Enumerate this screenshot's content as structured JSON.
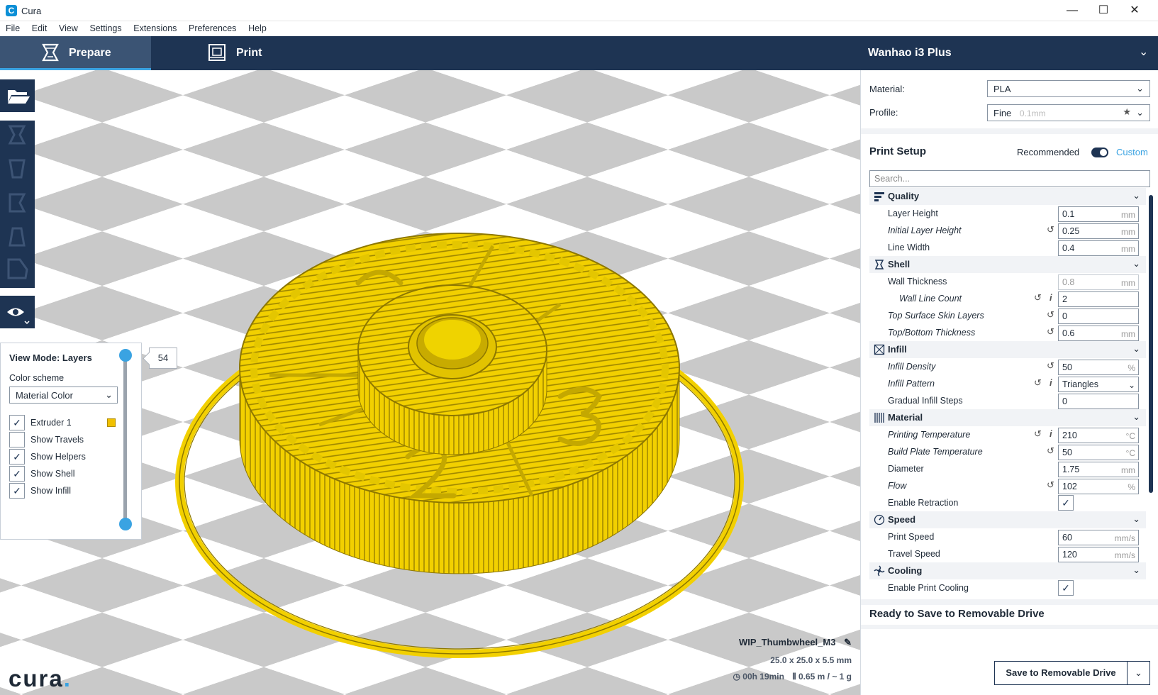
{
  "app": {
    "title": "Cura",
    "icon_letter": "C"
  },
  "window": {
    "minimize": "—",
    "maximize": "☐",
    "close": "✕"
  },
  "menu": [
    "File",
    "Edit",
    "View",
    "Settings",
    "Extensions",
    "Preferences",
    "Help"
  ],
  "tabs": {
    "prepare": "Prepare",
    "print": "Print"
  },
  "printer": {
    "name": "Wanhao i3 Plus"
  },
  "material": {
    "label": "Material:",
    "value": "PLA"
  },
  "profile": {
    "label": "Profile:",
    "value": "Fine",
    "hint": "0.1mm"
  },
  "print_setup": {
    "title": "Print Setup",
    "recommended": "Recommended",
    "custom": "Custom",
    "search_placeholder": "Search..."
  },
  "categories": {
    "quality": "Quality",
    "shell": "Shell",
    "infill": "Infill",
    "material": "Material",
    "speed": "Speed",
    "cooling": "Cooling"
  },
  "settings": {
    "layer_height": {
      "name": "Layer Height",
      "value": "0.1",
      "unit": "mm"
    },
    "initial_layer_height": {
      "name": "Initial Layer Height",
      "value": "0.25",
      "unit": "mm"
    },
    "line_width": {
      "name": "Line Width",
      "value": "0.4",
      "unit": "mm"
    },
    "wall_thickness": {
      "name": "Wall Thickness",
      "value": "0.8",
      "unit": "mm"
    },
    "wall_line_count": {
      "name": "Wall Line Count",
      "value": "2"
    },
    "top_surface_skin_layers": {
      "name": "Top Surface Skin Layers",
      "value": "0"
    },
    "top_bottom_thickness": {
      "name": "Top/Bottom Thickness",
      "value": "0.6",
      "unit": "mm"
    },
    "infill_density": {
      "name": "Infill Density",
      "value": "50",
      "unit": "%"
    },
    "infill_pattern": {
      "name": "Infill Pattern",
      "value": "Triangles"
    },
    "gradual_infill_steps": {
      "name": "Gradual Infill Steps",
      "value": "0"
    },
    "printing_temperature": {
      "name": "Printing Temperature",
      "value": "210",
      "unit": "°C"
    },
    "build_plate_temperature": {
      "name": "Build Plate Temperature",
      "value": "50",
      "unit": "°C"
    },
    "diameter": {
      "name": "Diameter",
      "value": "1.75",
      "unit": "mm"
    },
    "flow": {
      "name": "Flow",
      "value": "102",
      "unit": "%"
    },
    "enable_retraction": {
      "name": "Enable Retraction",
      "checked": true
    },
    "print_speed": {
      "name": "Print Speed",
      "value": "60",
      "unit": "mm/s"
    },
    "travel_speed": {
      "name": "Travel Speed",
      "value": "120",
      "unit": "mm/s"
    },
    "enable_print_cooling": {
      "name": "Enable Print Cooling",
      "checked": true
    }
  },
  "view_panel": {
    "title": "View Mode: Layers",
    "color_scheme_label": "Color scheme",
    "color_scheme_value": "Material Color",
    "extruder": "Extruder 1",
    "extruder_color": "#f0c000",
    "options": [
      {
        "label": "Show Travels",
        "checked": false
      },
      {
        "label": "Show Helpers",
        "checked": true
      },
      {
        "label": "Show Shell",
        "checked": true
      },
      {
        "label": "Show Infill",
        "checked": true
      }
    ],
    "layer": "54"
  },
  "job": {
    "name": "WIP_Thumbwheel_M3",
    "dimensions": "25.0 x 25.0 x 5.5 mm",
    "time": "00h 19min",
    "material_usage": "0.65 m / ~ 1 g"
  },
  "ready_text": "Ready to Save to Removable Drive",
  "save_button": "Save to Removable Drive",
  "check_mark": "✓",
  "logo": {
    "text": "cura",
    "dot": "."
  },
  "colors": {
    "navy": "#1e3453",
    "accent": "#3aa3e2",
    "model": "#f4d600"
  }
}
